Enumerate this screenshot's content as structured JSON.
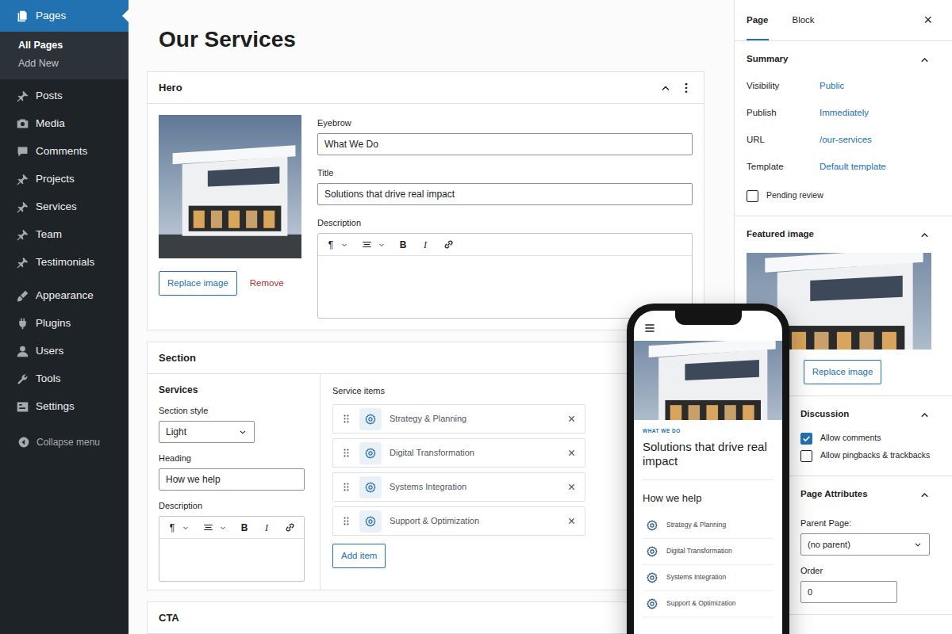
{
  "sidebar": {
    "items": [
      {
        "label": "Pages",
        "selected": true,
        "sub": [
          {
            "label": "All Pages",
            "selected": true
          },
          {
            "label": "Add New",
            "selected": false
          }
        ]
      },
      {
        "label": "Posts",
        "selected": false
      },
      {
        "label": "Media",
        "selected": false
      },
      {
        "label": "Comments",
        "selected": false
      },
      {
        "label": "Projects",
        "selected": false
      },
      {
        "label": "Services",
        "selected": false
      },
      {
        "label": "Team",
        "selected": false
      },
      {
        "label": "Testimonials",
        "selected": false
      },
      {
        "label": "Appearance",
        "selected": false
      },
      {
        "label": "Plugins",
        "selected": false
      },
      {
        "label": "Users",
        "selected": false
      },
      {
        "label": "Tools",
        "selected": false
      },
      {
        "label": "Settings",
        "selected": false
      }
    ],
    "collapse": "Collapse menu"
  },
  "page_title": "Our Services",
  "hero": {
    "title": "Hero",
    "expanded": true,
    "replace_button": "Replace image",
    "remove_link": "Remove",
    "fields": [
      {
        "label": "Eyebrow",
        "value": "What We Do"
      },
      {
        "label": "Title",
        "value": "Solutions that drive real impact"
      }
    ],
    "description": {
      "label": "Description",
      "toolbar": {
        "paragraph": "¶",
        "bold": "B",
        "italic": "I"
      }
    }
  },
  "section": {
    "title": "Section",
    "name": "Services",
    "style": {
      "label": "Section style",
      "value": "Light"
    },
    "heading": {
      "label": "Heading",
      "value": "How we help"
    },
    "description": {
      "label": "Description",
      "toolbar": {
        "paragraph": "¶",
        "bold": "B",
        "italic": "I"
      }
    },
    "items_label": "Service items",
    "items": [
      {
        "label": "Strategy & Planning",
        "remove": "×"
      },
      {
        "label": "Digital Transformation",
        "remove": "×"
      },
      {
        "label": "Systems Integration",
        "remove": "×"
      },
      {
        "label": "Support & Optimization",
        "remove": "×"
      }
    ],
    "add_button": "Add item"
  },
  "cta": {
    "title": "CTA"
  },
  "panel": {
    "tabs": [
      {
        "label": "Page",
        "selected": true
      },
      {
        "label": "Block",
        "selected": false
      }
    ],
    "close": "×",
    "summary": {
      "title": "Summary",
      "expanded": true,
      "rows": [
        {
          "label": "Visibility",
          "value": "Public"
        },
        {
          "label": "Publish",
          "value": "Immediately"
        },
        {
          "label": "URL",
          "value": "/our-services"
        },
        {
          "label": "Template",
          "value": "Default template"
        }
      ],
      "pending": {
        "label": "Pending review",
        "checked": false
      }
    },
    "featured": {
      "title": "Featured image",
      "expanded": true,
      "replace_button": "Replace image"
    },
    "discussion": {
      "title": "Discussion",
      "expanded": true,
      "options": [
        {
          "label": "Allow comments",
          "checked": true
        },
        {
          "label": "Allow pingbacks & trackbacks",
          "checked": false
        }
      ]
    },
    "attributes": {
      "title": "Page Attributes",
      "expanded": true,
      "parent": {
        "label": "Parent Page:",
        "value": "(no parent)"
      },
      "order": {
        "label": "Order",
        "value": "0"
      }
    }
  },
  "phone": {
    "eyebrow": "WHAT WE DO",
    "title": "Solutions that drive real impact",
    "heading": "How we help",
    "items": [
      {
        "label": "Strategy & Planning"
      },
      {
        "label": "Digital Transformation"
      },
      {
        "label": "Systems Integration"
      },
      {
        "label": "Support & Optimization"
      }
    ]
  }
}
